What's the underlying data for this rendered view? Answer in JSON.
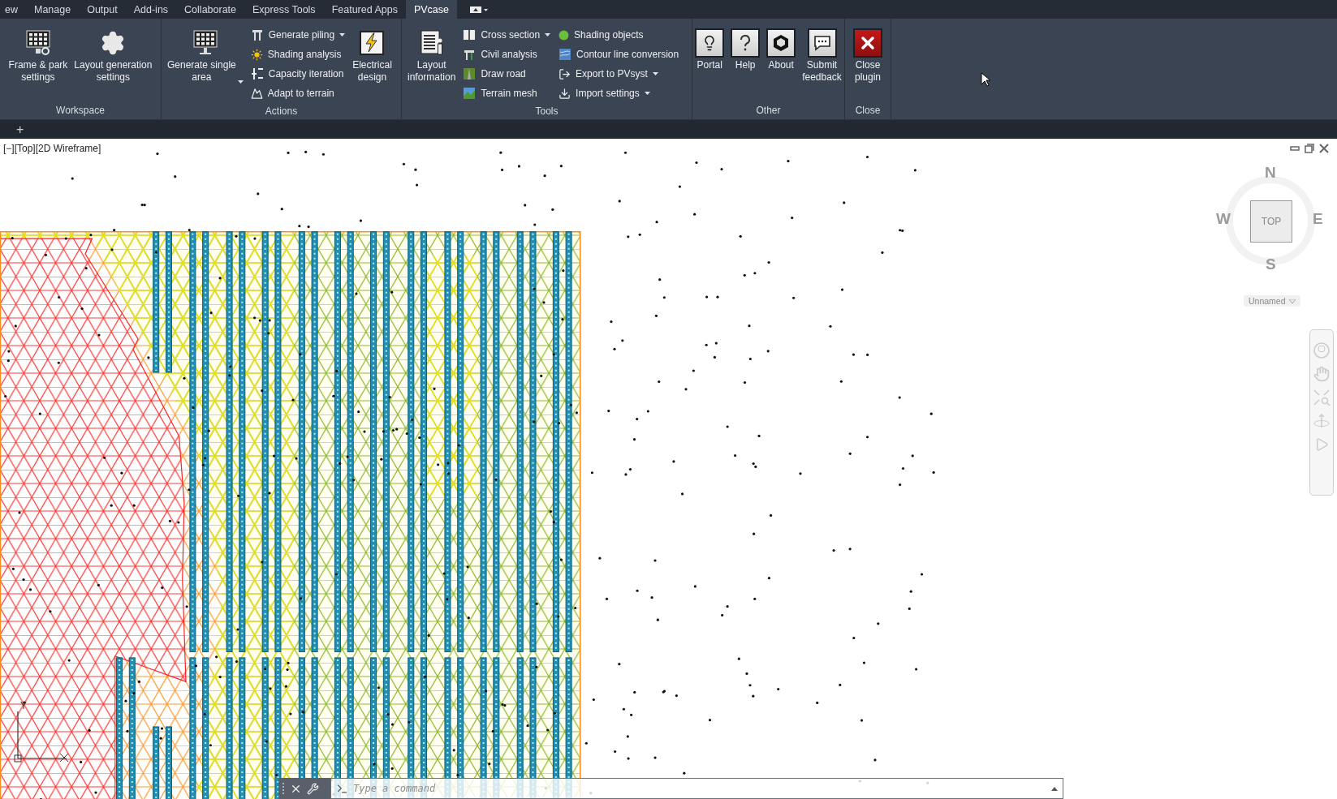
{
  "tabs": [
    {
      "label": "ew",
      "selected": false
    },
    {
      "label": "Manage",
      "selected": false
    },
    {
      "label": "Output",
      "selected": false
    },
    {
      "label": "Add-ins",
      "selected": false
    },
    {
      "label": "Collaborate",
      "selected": false
    },
    {
      "label": "Express Tools",
      "selected": false
    },
    {
      "label": "Featured Apps",
      "selected": false
    },
    {
      "label": "PVcase",
      "selected": true
    }
  ],
  "ribbon": {
    "panels": [
      {
        "title": "Workspace",
        "columns": [
          {
            "kind": "large",
            "lines": [
              "Frame & park",
              "settings"
            ],
            "has_menu": false
          },
          {
            "kind": "large",
            "lines": [
              "Layout generation",
              "settings"
            ],
            "has_menu": false
          }
        ]
      },
      {
        "title": "Actions",
        "columns": [
          {
            "kind": "large",
            "lines": [
              "Generate single",
              "area"
            ],
            "has_menu": true
          },
          {
            "kind": "stack",
            "items": [
              {
                "label": "Generate piling",
                "has_menu": true
              },
              {
                "label": "Shading analysis",
                "has_menu": false
              },
              {
                "label": "Capacity iteration",
                "has_menu": false
              },
              {
                "label": "Adapt to terrain",
                "has_menu": false
              }
            ]
          },
          {
            "kind": "large",
            "lines": [
              "Electrical",
              "design"
            ],
            "has_menu": false
          }
        ]
      },
      {
        "title": "Tools",
        "columns": [
          {
            "kind": "large",
            "lines": [
              "Layout",
              "information"
            ],
            "has_menu": false
          },
          {
            "kind": "stack",
            "items": [
              {
                "label": "Cross section",
                "has_menu": true
              },
              {
                "label": "Civil analysis",
                "has_menu": false
              },
              {
                "label": "Draw road",
                "has_menu": false
              },
              {
                "label": "Terrain mesh",
                "has_menu": false
              }
            ]
          },
          {
            "kind": "stack",
            "items": [
              {
                "label": "Shading objects",
                "has_menu": false
              },
              {
                "label": "Contour line conversion",
                "has_menu": false
              },
              {
                "label": "Export to PVsyst",
                "has_menu": true
              },
              {
                "label": "Import settings",
                "has_menu": true
              }
            ]
          }
        ]
      },
      {
        "title": "Other",
        "columns": [
          {
            "kind": "framed",
            "lines": [
              "Portal"
            ],
            "has_menu": false
          },
          {
            "kind": "framed",
            "lines": [
              "Help"
            ],
            "has_menu": false
          },
          {
            "kind": "framed",
            "lines": [
              "About"
            ],
            "has_menu": false
          },
          {
            "kind": "framed",
            "lines": [
              "Submit",
              "feedback"
            ],
            "has_menu": false
          }
        ]
      },
      {
        "title": "Close",
        "columns": [
          {
            "kind": "alert",
            "lines": [
              "Close",
              "plugin"
            ],
            "has_menu": false
          }
        ]
      }
    ]
  },
  "file_tabs": {
    "add": "+"
  },
  "viewport": {
    "label": "[−][Top][2D Wireframe]",
    "viewcube": {
      "face": "TOP",
      "north": "N",
      "east": "E",
      "south": "S",
      "west": "W",
      "view_name": "Unnamed"
    },
    "ucs": {
      "y": "Y"
    }
  },
  "command_line": {
    "placeholder": "Type a command"
  }
}
